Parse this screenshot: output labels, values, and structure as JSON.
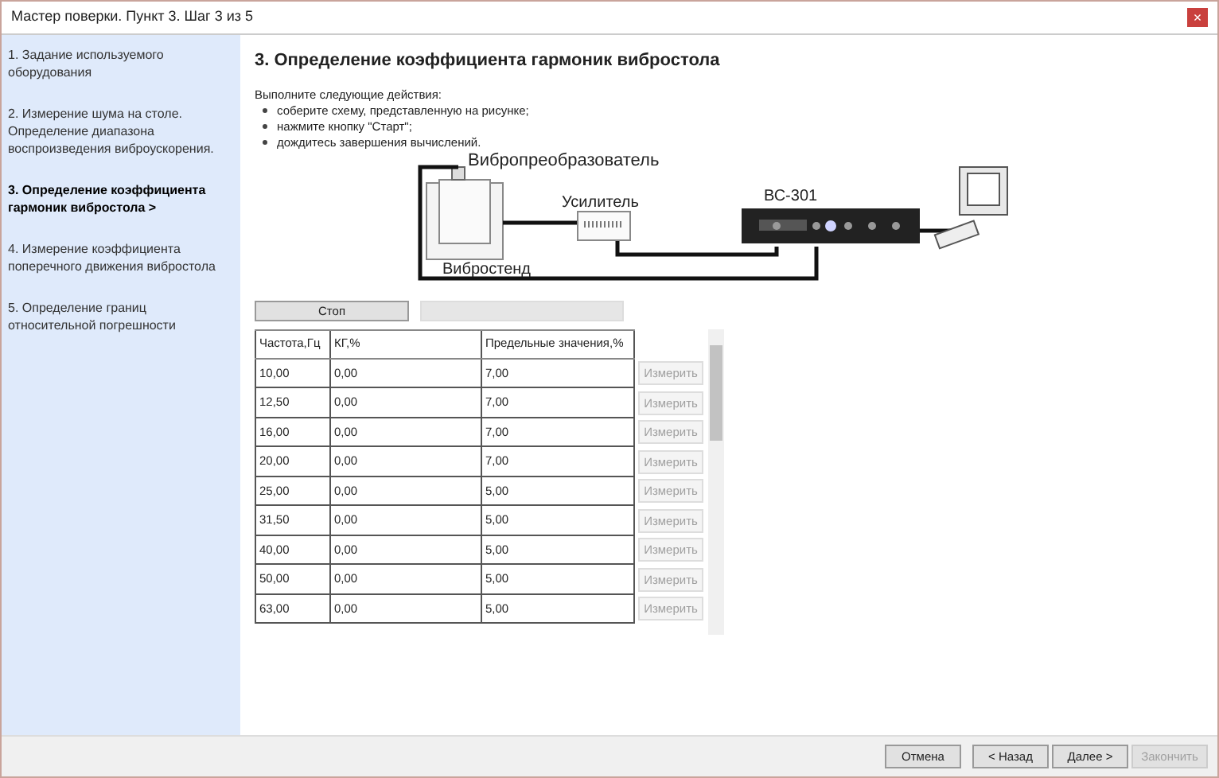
{
  "window": {
    "title": "Мастер поверки. Пункт 3. Шаг 3 из 5",
    "close": "×"
  },
  "steps": [
    {
      "label": "1.  Задание используемого оборудования",
      "selected": false
    },
    {
      "label": "2.  Измерение шума на столе. Определение диапазона воспроизведения виброускорения.",
      "selected": false
    },
    {
      "label": "3.  Определение коэффициента гармоник вибростола >",
      "selected": true
    },
    {
      "label": "4.  Измерение коэффициента поперечного движения вибростола",
      "selected": false
    },
    {
      "label": "5.  Определение границ относительной погрешности",
      "selected": false
    }
  ],
  "heading": "3.  Определение коэффициента гармоник вибростола",
  "instructions": {
    "intro": "Выполните следующие действия:",
    "items": [
      "соберите схему, представленную на рисунке;",
      "нажмите кнопку \"Старт\";",
      "дождитесь завершения вычислений."
    ]
  },
  "diagram": {
    "sensor": "Вибропреобразователь",
    "amplifier": "Усилитель",
    "device": "ВС-301",
    "stand": "Вибростенд"
  },
  "stop_button": "Стоп",
  "progress": {
    "level": 0
  },
  "table": {
    "columns": [
      "Частота,Гц",
      "КГ,%",
      "Предельные значения,%"
    ],
    "rows": [
      {
        "cells": [
          "10,00",
          "0,00",
          "7,00"
        ],
        "button": "Измерить",
        "disabled": true
      },
      {
        "cells": [
          "12,50",
          "0,00",
          "7,00"
        ],
        "button": "Измерить",
        "disabled": true
      },
      {
        "cells": [
          "16,00",
          "0,00",
          "7,00"
        ],
        "button": "Измерить",
        "disabled": true
      },
      {
        "cells": [
          "20,00",
          "0,00",
          "7,00"
        ],
        "button": "Измерить",
        "disabled": true
      },
      {
        "cells": [
          "25,00",
          "0,00",
          "5,00"
        ],
        "button": "Измерить",
        "disabled": true
      },
      {
        "cells": [
          "31,50",
          "0,00",
          "5,00"
        ],
        "button": "Измерить",
        "disabled": true
      },
      {
        "cells": [
          "40,00",
          "0,00",
          "5,00"
        ],
        "button": "Измерить",
        "disabled": true
      },
      {
        "cells": [
          "50,00",
          "0,00",
          "5,00"
        ],
        "button": "Измерить",
        "disabled": true
      },
      {
        "cells": [
          "63,00",
          "0,00",
          "5,00"
        ],
        "button": "Измерить",
        "disabled": true
      }
    ]
  },
  "footer_buttons": [
    {
      "label": "Отмена",
      "disabled": false
    },
    {
      "label": "< Назад",
      "disabled": false
    },
    {
      "label": "Далее >",
      "disabled": false
    },
    {
      "label": "Закончить",
      "disabled": true
    }
  ]
}
